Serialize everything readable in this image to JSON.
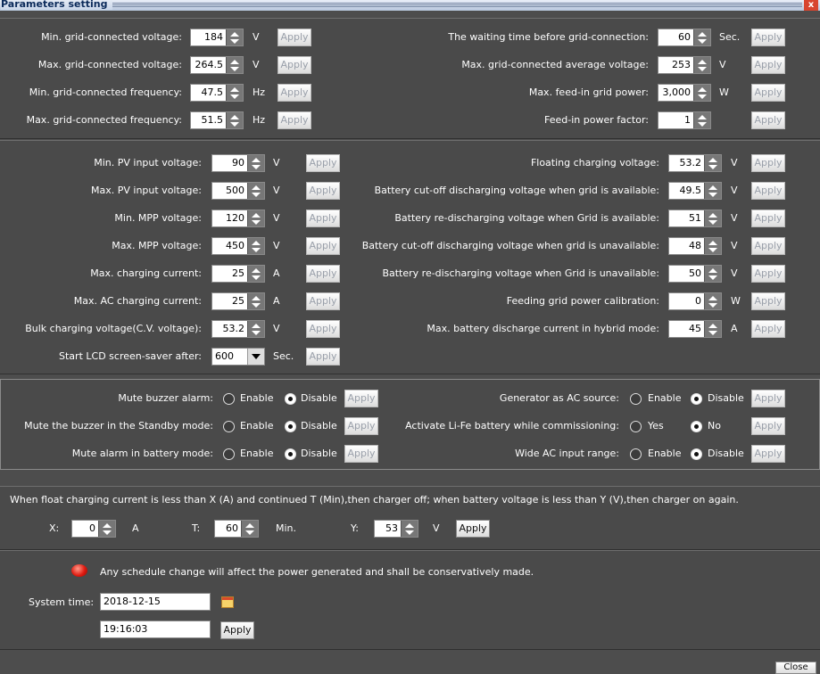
{
  "window": {
    "title": "Parameters setting",
    "close_label": "x",
    "bottom_button_label": "Close"
  },
  "grid": {
    "left": [
      {
        "label": "Min. grid-connected voltage:",
        "value": "184",
        "unit": "V",
        "apply": "Apply"
      },
      {
        "label": "Max. grid-connected voltage:",
        "value": "264.5",
        "unit": "V",
        "apply": "Apply"
      },
      {
        "label": "Min. grid-connected frequency:",
        "value": "47.5",
        "unit": "Hz",
        "apply": "Apply"
      },
      {
        "label": "Max. grid-connected frequency:",
        "value": "51.5",
        "unit": "Hz",
        "apply": "Apply"
      }
    ],
    "right": [
      {
        "label": "The waiting time before grid-connection:",
        "value": "60",
        "unit": "Sec.",
        "apply": "Apply"
      },
      {
        "label": "Max. grid-connected average voltage:",
        "value": "253",
        "unit": "V",
        "apply": "Apply"
      },
      {
        "label": "Max. feed-in grid power:",
        "value": "3,000",
        "unit": "W",
        "apply": "Apply"
      },
      {
        "label": "Feed-in power factor:",
        "value": "1",
        "unit": "",
        "apply": "Apply"
      }
    ]
  },
  "pv": {
    "left": [
      {
        "label": "Min. PV input voltage:",
        "value": "90",
        "unit": "V",
        "apply": "Apply"
      },
      {
        "label": "Max. PV input voltage:",
        "value": "500",
        "unit": "V",
        "apply": "Apply"
      },
      {
        "label": "Min. MPP voltage:",
        "value": "120",
        "unit": "V",
        "apply": "Apply"
      },
      {
        "label": "Max. MPP voltage:",
        "value": "450",
        "unit": "V",
        "apply": "Apply"
      },
      {
        "label": "Max. charging current:",
        "value": "25",
        "unit": "A",
        "apply": "Apply"
      },
      {
        "label": "Max. AC charging current:",
        "value": "25",
        "unit": "A",
        "apply": "Apply"
      },
      {
        "label": "Bulk charging voltage(C.V. voltage):",
        "value": "53.2",
        "unit": "V",
        "apply": "Apply"
      }
    ],
    "lcd": {
      "label": "Start LCD screen-saver after:",
      "value": "600",
      "unit": "Sec.",
      "apply": "Apply"
    },
    "right": [
      {
        "label": "Floating charging voltage:",
        "value": "53.2",
        "unit": "V",
        "apply": "Apply"
      },
      {
        "label": "Battery cut-off discharging voltage when grid is available:",
        "value": "49.5",
        "unit": "V",
        "apply": "Apply"
      },
      {
        "label": "Battery re-discharging voltage when Grid is available:",
        "value": "51",
        "unit": "V",
        "apply": "Apply"
      },
      {
        "label": "Battery cut-off discharging voltage when grid is unavailable:",
        "value": "48",
        "unit": "V",
        "apply": "Apply"
      },
      {
        "label": "Battery re-discharging voltage when Grid is unavailable:",
        "value": "50",
        "unit": "V",
        "apply": "Apply"
      },
      {
        "label": "Feeding grid power calibration:",
        "value": "0",
        "unit": "W",
        "apply": "Apply"
      },
      {
        "label": "Max. battery discharge current in hybrid mode:",
        "value": "45",
        "unit": "A",
        "apply": "Apply"
      }
    ]
  },
  "options": {
    "left": [
      {
        "label": "Mute buzzer alarm:",
        "opt1": "Enable",
        "opt2": "Disable",
        "selected": "Disable",
        "apply": "Apply"
      },
      {
        "label": "Mute the buzzer in the Standby mode:",
        "opt1": "Enable",
        "opt2": "Disable",
        "selected": "Disable",
        "apply": "Apply"
      },
      {
        "label": "Mute alarm in battery mode:",
        "opt1": "Enable",
        "opt2": "Disable",
        "selected": "Disable",
        "apply": "Apply"
      }
    ],
    "right": [
      {
        "label": "Generator as AC source:",
        "opt1": "Enable",
        "opt2": "Disable",
        "selected": "Disable",
        "apply": "Apply"
      },
      {
        "label": "Activate Li-Fe battery while commissioning:",
        "opt1": "Yes",
        "opt2": "No",
        "selected": "No",
        "apply": "Apply"
      },
      {
        "label": "Wide AC input range:",
        "opt1": "Enable",
        "opt2": "Disable",
        "selected": "Disable",
        "apply": "Apply"
      }
    ]
  },
  "float": {
    "description": "When float charging current is less than X (A) and continued T (Min),then charger off; when battery voltage is less than Y (V),then charger on again.",
    "x_label": "X:",
    "x_value": "0",
    "x_unit": "A",
    "t_label": "T:",
    "t_value": "60",
    "t_unit": "Min.",
    "y_label": "Y:",
    "y_value": "53",
    "y_unit": "V",
    "apply": "Apply"
  },
  "schedule": {
    "warning": "Any schedule change will affect the power generated and shall be conservatively made.",
    "time_label": "System time:",
    "date": "2018-12-15",
    "time": "19:16:03",
    "apply": "Apply"
  }
}
